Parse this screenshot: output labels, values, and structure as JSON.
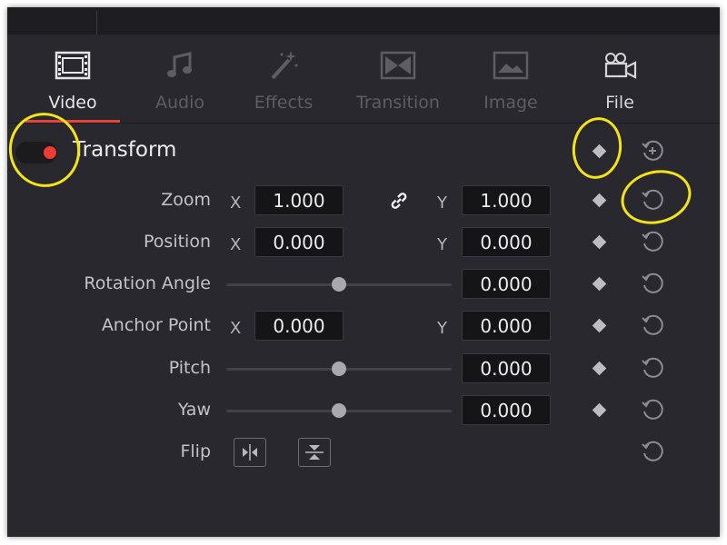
{
  "tabs": [
    {
      "label": "Video",
      "icon": "film-icon",
      "active": true
    },
    {
      "label": "Audio",
      "icon": "music-note-icon",
      "active": false
    },
    {
      "label": "Effects",
      "icon": "magic-wand-icon",
      "active": false
    },
    {
      "label": "Transition",
      "icon": "transition-icon",
      "active": false
    },
    {
      "label": "Image",
      "icon": "image-icon",
      "active": false
    },
    {
      "label": "File",
      "icon": "camera-icon",
      "active": false
    }
  ],
  "transform": {
    "title": "Transform",
    "enabled": true,
    "rows": {
      "zoom": {
        "label": "Zoom",
        "x_axis": "X",
        "x": "1.000",
        "y_axis": "Y",
        "y": "1.000"
      },
      "position": {
        "label": "Position",
        "x_axis": "X",
        "x": "0.000",
        "y_axis": "Y",
        "y": "0.000"
      },
      "rotation": {
        "label": "Rotation Angle",
        "value": "0.000",
        "slider_level": 0.5
      },
      "anchor": {
        "label": "Anchor Point",
        "x_axis": "X",
        "x": "0.000",
        "y_axis": "Y",
        "y": "0.000"
      },
      "pitch": {
        "label": "Pitch",
        "value": "0.000",
        "slider_level": 0.5
      },
      "yaw": {
        "label": "Yaw",
        "value": "0.000",
        "slider_level": 0.5
      },
      "flip": {
        "label": "Flip"
      }
    }
  },
  "colors": {
    "panel_bg": "#28282e",
    "accent_red": "#e2453a",
    "toggle_dot": "#ef3b33",
    "annotation_yellow": "#f5e31a"
  }
}
